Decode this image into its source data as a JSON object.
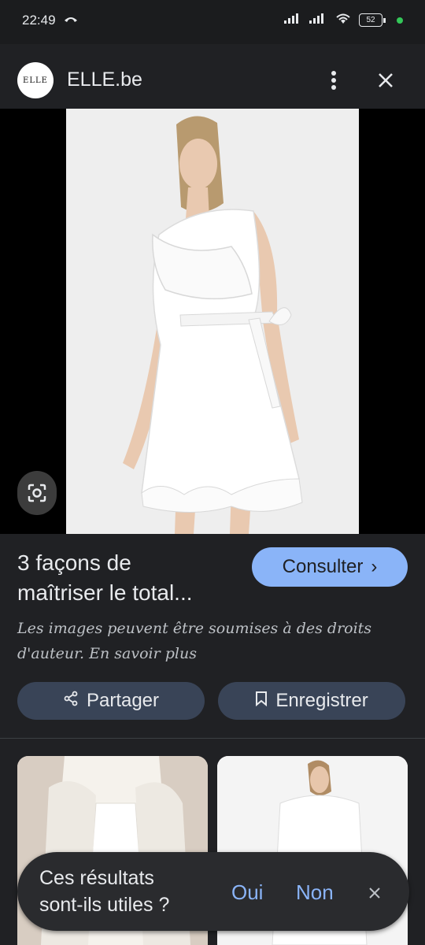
{
  "status_bar": {
    "time": "22:49",
    "battery": "52",
    "icons": [
      "call-icon",
      "signal-icon",
      "signal-icon",
      "wifi-icon",
      "battery-icon"
    ]
  },
  "header": {
    "logo_text": "ELLE",
    "site_name": "ELLE.be",
    "menu_icon": "more-vert-icon",
    "close_icon": "close-icon"
  },
  "image": {
    "lens_icon": "google-lens-icon"
  },
  "result": {
    "title_line1": "3 façons de",
    "title_line2": "maîtriser le total...",
    "visit_label": "Consulter",
    "visit_arrow": "›",
    "disclaimer_line1": "Les images peuvent être soumises à des droits",
    "disclaimer_line2": "d'auteur. En savoir plus"
  },
  "actions": {
    "share_label": "Partager",
    "save_label": "Enregistrer"
  },
  "feedback": {
    "question_line1": "Ces résultats",
    "question_line2": "sont-ils utiles ?",
    "yes_label": "Oui",
    "no_label": "Non"
  },
  "colors": {
    "background": "#202124",
    "accent": "#8ab4f8",
    "pill": "#394457"
  }
}
